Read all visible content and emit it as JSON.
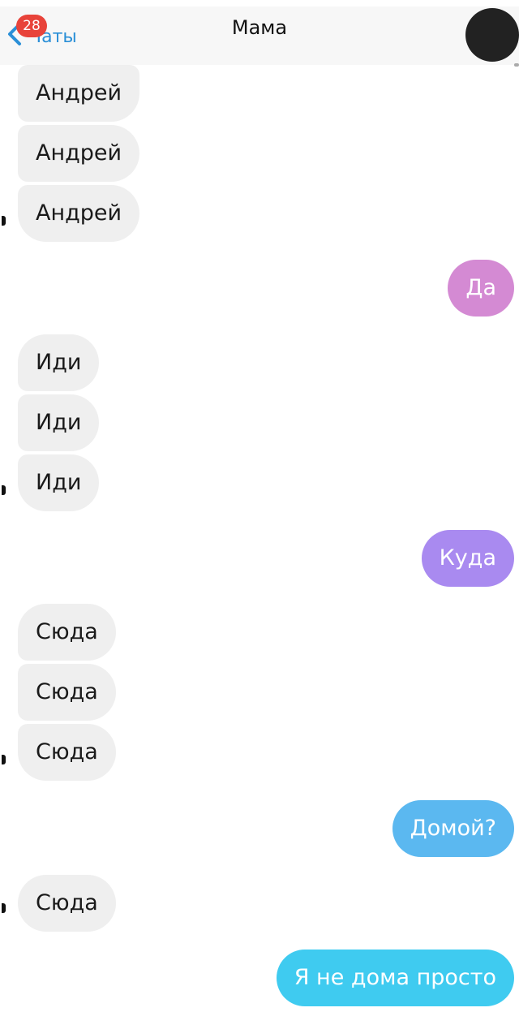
{
  "header": {
    "back_label": "Чаты",
    "unread_count": "28",
    "title": "Мама",
    "back_icon": "chevron-left-icon",
    "accent_color": "#2a8fd7",
    "badge_color": "#e8433a"
  },
  "messages": [
    {
      "side": "incoming",
      "text": "Андрей"
    },
    {
      "side": "incoming",
      "text": "Андрей"
    },
    {
      "side": "incoming",
      "text": "Андрей"
    },
    {
      "side": "outgoing",
      "text": "Да",
      "color": "#d48ad3"
    },
    {
      "side": "incoming",
      "text": "Иди"
    },
    {
      "side": "incoming",
      "text": "Иди"
    },
    {
      "side": "incoming",
      "text": "Иди"
    },
    {
      "side": "outgoing",
      "text": "Куда",
      "color": "#a98af0"
    },
    {
      "side": "incoming",
      "text": "Сюда"
    },
    {
      "side": "incoming",
      "text": "Сюда"
    },
    {
      "side": "incoming",
      "text": "Сюда"
    },
    {
      "side": "outgoing",
      "text": "Домой?",
      "color": "#5bb8f0"
    },
    {
      "side": "incoming",
      "text": "Сюда"
    },
    {
      "side": "outgoing",
      "text": "Я не дома просто",
      "color": "#3fcbf0"
    }
  ]
}
